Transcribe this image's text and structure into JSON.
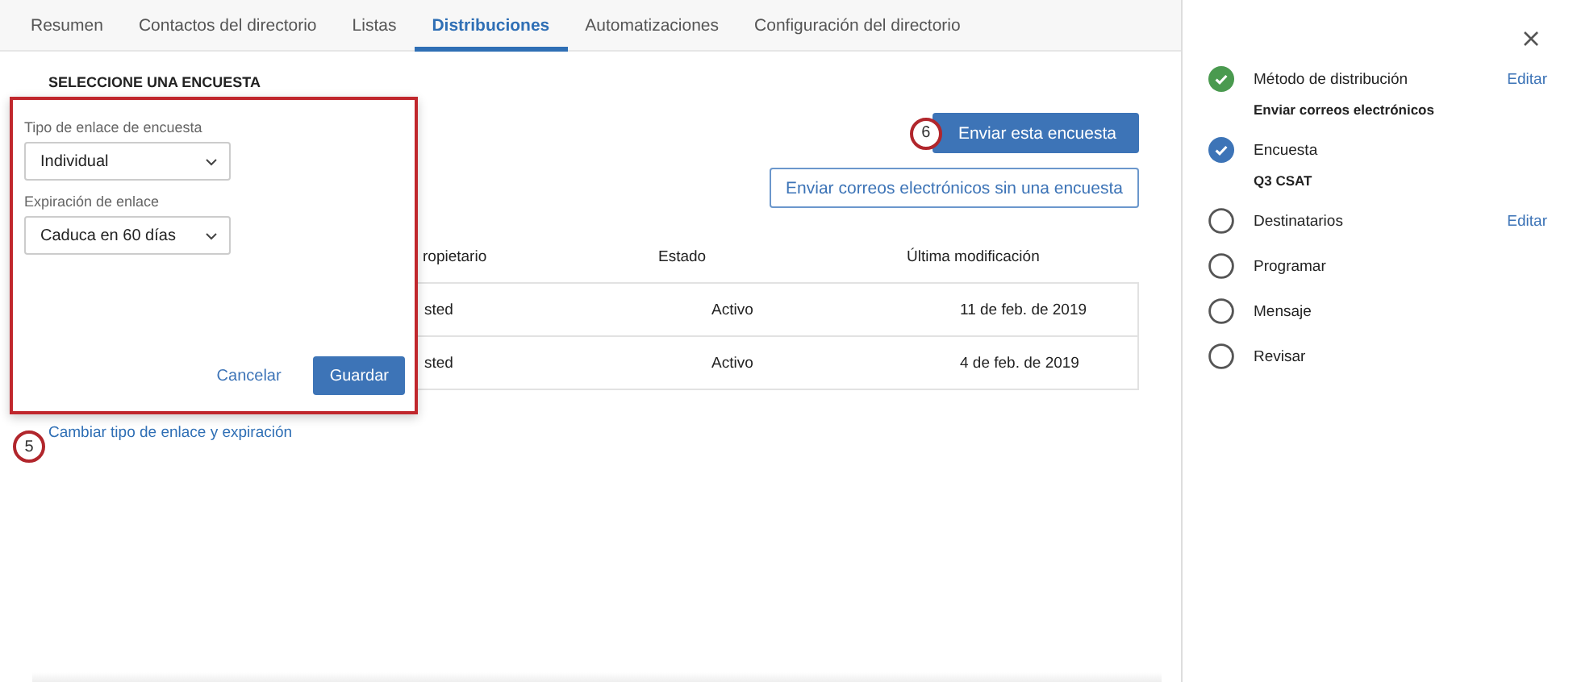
{
  "tabs": [
    {
      "label": "Resumen",
      "selected": false
    },
    {
      "label": "Contactos del directorio",
      "selected": false
    },
    {
      "label": "Listas",
      "selected": false
    },
    {
      "label": "Distribuciones",
      "selected": true
    },
    {
      "label": "Automatizaciones",
      "selected": false
    },
    {
      "label": "Configuración del directorio",
      "selected": false
    }
  ],
  "section_title": "SELECCIONE UNA ENCUESTA",
  "buttons": {
    "primary": "Enviar esta encuesta",
    "secondary": "Enviar correos electrónicos sin una encuesta"
  },
  "table": {
    "columns": [
      "ropietario",
      "Estado",
      "Última modificación"
    ],
    "rows": [
      [
        "sted",
        "Activo",
        "11 de feb. de 2019"
      ],
      [
        "sted",
        "Activo",
        "4 de feb. de 2019"
      ]
    ]
  },
  "popup": {
    "fields": [
      {
        "label": "Tipo de enlace de encuesta",
        "value": "Individual"
      },
      {
        "label": "Expiración de enlace",
        "value": "Caduca en 60 días"
      }
    ],
    "cancel": "Cancelar",
    "save": "Guardar"
  },
  "link": "Cambiar tipo de enlace y expiración",
  "callouts": [
    {
      "number": "5"
    },
    {
      "number": "6"
    }
  ],
  "panel": {
    "steps": [
      {
        "title": "Método de distribución",
        "kind": "complete",
        "detail": "Enviar correos electrónicos",
        "action": "Editar"
      },
      {
        "title": "Encuesta",
        "kind": "current",
        "detail": "Q3 CSAT"
      },
      {
        "title": "Destinatarios",
        "kind": "pending",
        "action": "Editar"
      },
      {
        "title": "Programar",
        "kind": "pending"
      },
      {
        "title": "Mensaje",
        "kind": "pending"
      },
      {
        "title": "Revisar",
        "kind": "pending"
      }
    ]
  }
}
